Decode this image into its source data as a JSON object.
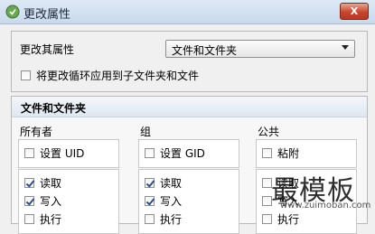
{
  "window": {
    "title": "更改属性",
    "close_label": "X"
  },
  "change_panel": {
    "field_label": "更改其属性",
    "select_value": "文件和文件夹",
    "recursive_label": "将更改循环应用到子文件夹和文件"
  },
  "section": {
    "title": "文件和文件夹",
    "owner": {
      "title": "所有者",
      "setid_label": "设置 UID",
      "read_label": "读取",
      "write_label": "写入",
      "exec_label": "执行"
    },
    "group": {
      "title": "组",
      "setid_label": "设置 GID",
      "read_label": "读取",
      "write_label": "写入",
      "exec_label": "执行"
    },
    "others": {
      "title": "公共",
      "sticky_label": "粘附",
      "read_label": "读取",
      "write_label": "写入",
      "exec_label": "执行"
    }
  },
  "watermark": {
    "big": "最模板",
    "small": "www.zuimoban.com"
  }
}
